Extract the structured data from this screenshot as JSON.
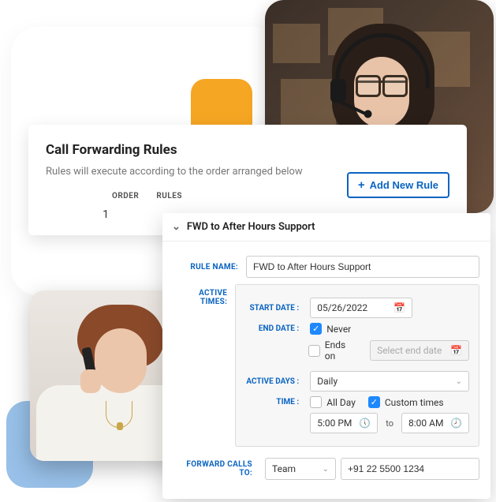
{
  "rules_card": {
    "title": "Call Forwarding Rules",
    "subtitle": "Rules will execute according to the order arranged below",
    "headers": {
      "order": "ORDER",
      "rules": "RULES"
    },
    "row": {
      "order": "1"
    },
    "add_button": "Add New Rule"
  },
  "detail": {
    "header_title": "FWD to After Hours Support",
    "labels": {
      "rule_name": "RULE NAME:",
      "active_times": "ACTIVE TIMES:",
      "start_date": "START DATE :",
      "end_date": "END DATE :",
      "active_days": "ACTIVE DAYS :",
      "time": "TIME :",
      "forward_to": "FORWARD CALLS TO:"
    },
    "rule_name_value": "FWD to After Hours Support",
    "start_date": "05/26/2022",
    "never_label": "Never",
    "ends_on_label": "Ends on",
    "end_date_placeholder": "Select end date",
    "active_days_value": "Daily",
    "all_day_label": "All Day",
    "custom_times_label": "Custom times",
    "time_from": "5:00 PM",
    "time_to_word": "to",
    "time_to": "8:00 AM",
    "forward_target": "Team",
    "forward_number": "+91 22 5500 1234"
  }
}
